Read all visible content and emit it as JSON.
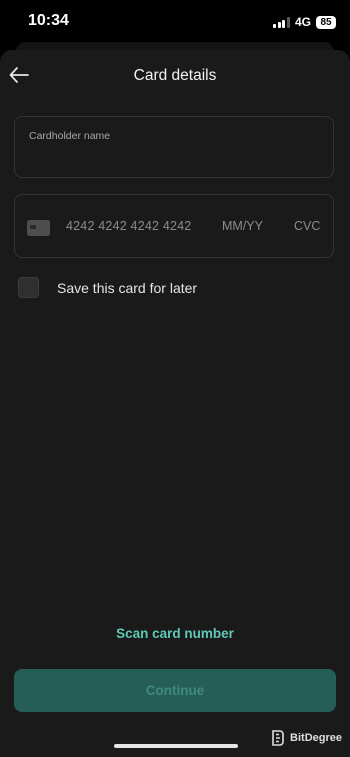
{
  "status_bar": {
    "time": "10:34",
    "network": "4G",
    "battery": "85",
    "signal_icon": "cellular-signal-icon",
    "battery_icon": "battery-icon"
  },
  "header": {
    "title": "Card details",
    "back_icon": "arrow-left-icon"
  },
  "form": {
    "cardholder_label": "Cardholder name",
    "cardholder_value": "",
    "card_icon": "credit-card-icon",
    "card_number_placeholder": "4242 4242 4242 4242",
    "expiry_placeholder": "MM/YY",
    "cvc_placeholder": "CVC",
    "save_card_label": "Save this card for later",
    "save_card_checked": false
  },
  "actions": {
    "scan_label": "Scan card number",
    "continue_label": "Continue",
    "continue_enabled": false
  },
  "watermark": {
    "text": "BitDegree",
    "logo": "bitdegree-logo"
  },
  "colors": {
    "background": "#1a1a1a",
    "accent": "#5ec9b4",
    "button_disabled_bg": "#255e56",
    "button_disabled_text": "#3f8a7f"
  }
}
